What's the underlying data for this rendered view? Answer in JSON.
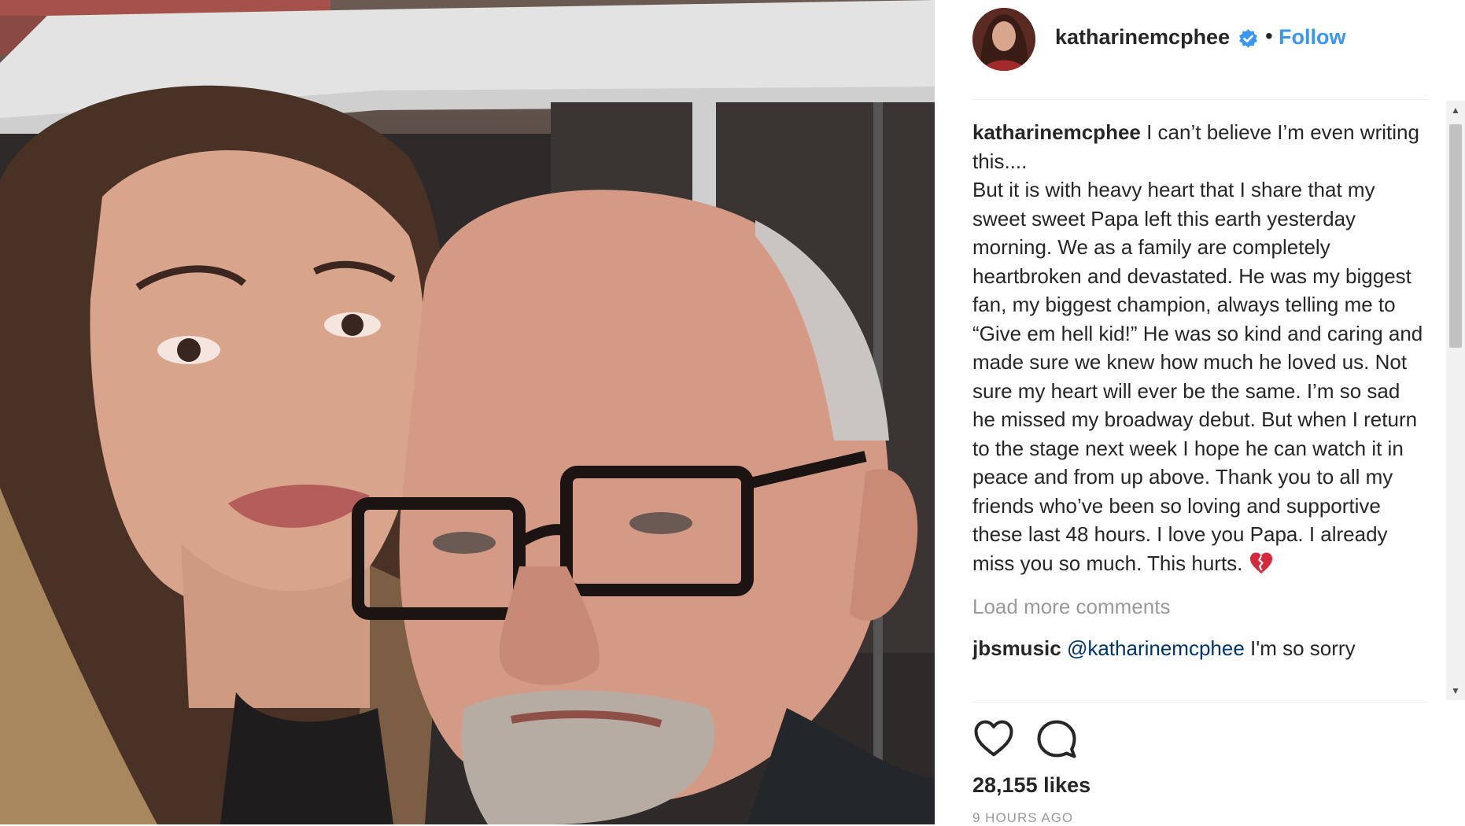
{
  "post": {
    "username": "katharinemcphee",
    "verified": true,
    "follow_label": "Follow",
    "separator": "•"
  },
  "caption": {
    "username": "katharinemcphee",
    "text": " I can’t believe I’m even writing this....\nBut it is with heavy heart that I share that my sweet sweet Papa left this earth yesterday morning. We as a family are completely heartbroken and devastated. He was my biggest fan, my biggest champion, always telling me to “Give em hell kid!” He was so kind and caring and made sure we knew how much he loved us. Not sure my heart will ever be the same. I’m so sad he missed my broadway debut. But when I return to the stage next week I hope he can watch it in peace and from up above. Thank you to all my friends who’ve been so loving and supportive these last 48 hours. I love you Papa. I already miss you so much. This hurts. ",
    "emoji": "broken-heart-icon"
  },
  "load_more_label": "Load more comments",
  "next_comment": {
    "username": "jbsmusic",
    "mention": "@katharinemcphee",
    "text": " I'm so sorry"
  },
  "likes": "28,155 likes",
  "timestamp": "9 HOURS AGO",
  "icons": {
    "like": "heart-outline-icon",
    "comment": "comment-bubble-icon",
    "verified": "verified-badge-icon"
  },
  "colors": {
    "link": "#3897f0",
    "verified": "#3897f0",
    "secondary_text": "#999999",
    "text": "#262626"
  }
}
